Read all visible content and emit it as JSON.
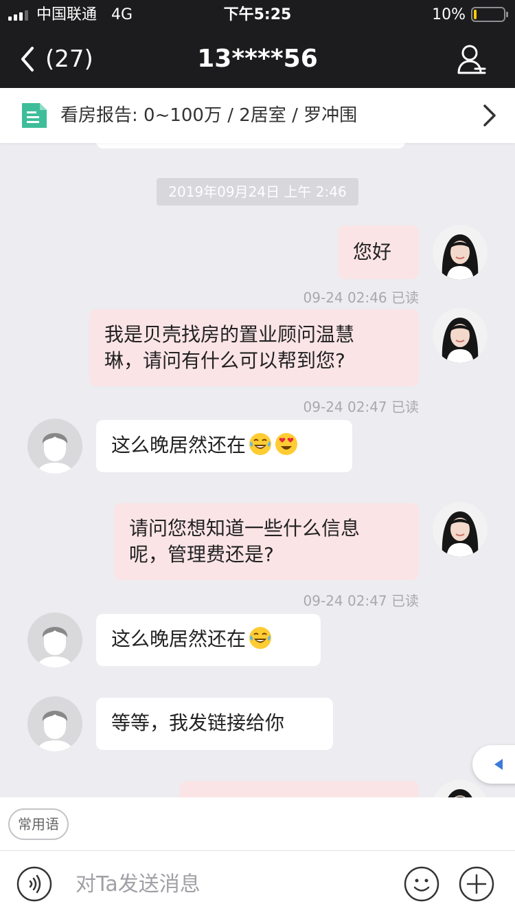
{
  "status_bar": {
    "carrier": "中国联通",
    "network": "4G",
    "time": "下午5:25",
    "battery": "10%",
    "battery_level": 0.1,
    "icons": [
      "signal-icon",
      "battery-icon"
    ]
  },
  "nav": {
    "back_count": "(27)",
    "title": "13****56",
    "icons": [
      "chevron-left-icon",
      "profile-icon"
    ]
  },
  "report": {
    "text": "看房报告: 0~100万 / 2居室 / 罗冲围",
    "icons": [
      "document-icon",
      "chevron-right-icon"
    ]
  },
  "chat": {
    "date_separator": "2019年09月24日 上午 2:46",
    "messages": [
      {
        "side": "out",
        "text": "您好",
        "meta": "09-24 02:46 已读"
      },
      {
        "side": "out",
        "text_lines": [
          "我是贝壳找房的置业顾问温慧",
          "琳，请问有什么可以帮到您?"
        ],
        "meta": "09-24 02:47 已读"
      },
      {
        "side": "in",
        "text": "这么晚居然还在",
        "emojis": [
          "laughing-tears-emoji",
          "heart-eyes-emoji"
        ]
      },
      {
        "side": "out",
        "text_lines": [
          "请问您想知道一些什么信息",
          "呢，管理费还是?"
        ],
        "meta": "09-24 02:47 已读"
      },
      {
        "side": "in",
        "text": "这么晚居然还在",
        "emojis": [
          "laughing-tears-emoji"
        ]
      },
      {
        "side": "in",
        "text": "等等，我发链接给你"
      }
    ]
  },
  "quick_bar": {
    "label": "常用语"
  },
  "input_bar": {
    "placeholder": "对Ta发送消息",
    "icons": [
      "voice-icon",
      "emoji-icon",
      "plus-icon"
    ]
  },
  "colors": {
    "bar_dark": "#1c1c1e",
    "chat_bg": "#ececf1",
    "outgoing_bubble": "#fbe4e6",
    "incoming_bubble": "#ffffff",
    "report_icon": "#3ebd9a"
  }
}
